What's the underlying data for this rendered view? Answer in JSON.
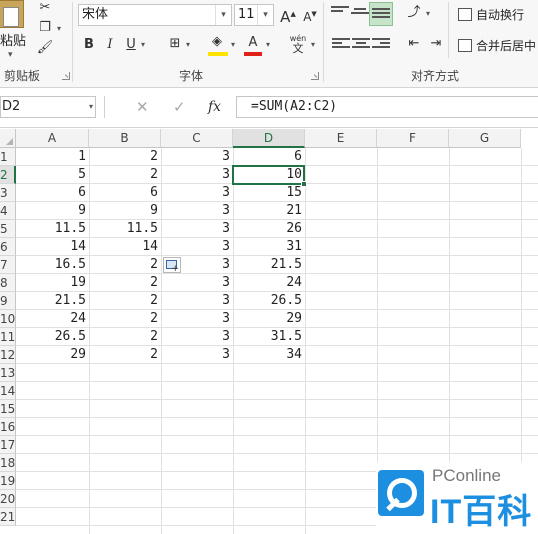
{
  "ribbon": {
    "clipboard": {
      "paste_label": "粘贴",
      "group_label": "剪贴板"
    },
    "font": {
      "font_name": "宋体",
      "font_size": "11",
      "bold": "B",
      "italic": "I",
      "underline": "U",
      "grow_font": "A",
      "shrink_font": "A",
      "font_color_letter": "A",
      "phonetic": "wén",
      "group_label": "字体"
    },
    "alignment": {
      "wrap_text": "自动换行",
      "merge_center": "合并后居中",
      "group_label": "对齐方式"
    }
  },
  "formula_bar": {
    "name_box": "D2",
    "cancel_icon": "✕",
    "enter_icon": "✓",
    "fx_label": "fx",
    "formula": "=SUM(A2:C2)"
  },
  "grid": {
    "columns": [
      "A",
      "B",
      "C",
      "D",
      "E",
      "F",
      "G"
    ],
    "row_numbers": [
      "1",
      "2",
      "3",
      "4",
      "5",
      "6",
      "7",
      "8",
      "9",
      "10",
      "11",
      "12",
      "13",
      "14",
      "15",
      "16",
      "17",
      "18",
      "19",
      "20",
      "21"
    ],
    "selected_cell": "D2",
    "rows": [
      [
        "1",
        "2",
        "3",
        "6"
      ],
      [
        "5",
        "2",
        "3",
        "10"
      ],
      [
        "6",
        "6",
        "3",
        "15"
      ],
      [
        "9",
        "9",
        "3",
        "21"
      ],
      [
        "11.5",
        "11.5",
        "3",
        "26"
      ],
      [
        "14",
        "14",
        "3",
        "31"
      ],
      [
        "16.5",
        "2",
        "3",
        "21.5"
      ],
      [
        "19",
        "2",
        "3",
        "24"
      ],
      [
        "21.5",
        "2",
        "3",
        "26.5"
      ],
      [
        "24",
        "2",
        "3",
        "29"
      ],
      [
        "26.5",
        "2",
        "3",
        "31.5"
      ],
      [
        "29",
        "2",
        "3",
        "34"
      ]
    ]
  },
  "watermark": {
    "top_text": "PConline",
    "bottom_text": "IT百科"
  },
  "colors": {
    "accent": "#217346",
    "watermark_blue": "#1d8fe0",
    "font_color": "#e0201b",
    "highlight": "#ffe200"
  }
}
